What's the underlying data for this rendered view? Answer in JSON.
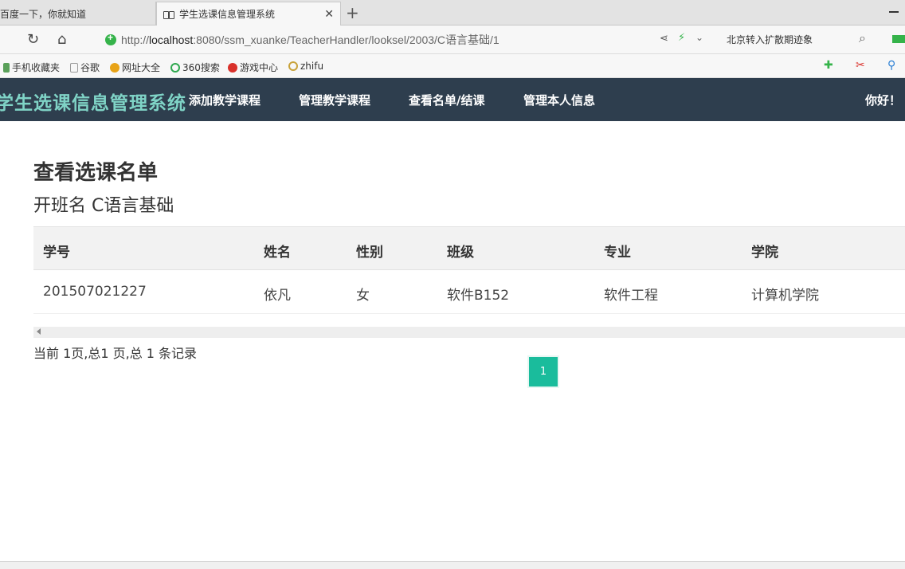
{
  "browser": {
    "tabs": [
      {
        "label": "百度一下，你就知道"
      },
      {
        "label": "学生选课信息管理系统"
      }
    ],
    "url": {
      "prefix": "http://",
      "host": "localhost",
      "rest": ":8080/ssm_xuanke/TeacherHandler/looksel/2003/C语言基础/1"
    },
    "news_ticker": "北京转入扩散期迹象",
    "bookmarks": [
      {
        "label": "手机收藏夹",
        "color": "#5aa05a"
      },
      {
        "label": "谷歌",
        "color": "#9a9a9a"
      },
      {
        "label": "网址大全",
        "color": "#e8a317"
      },
      {
        "label": "360搜索",
        "color": "#2fa84f"
      },
      {
        "label": "游戏中心",
        "color": "#d9312b"
      },
      {
        "label": "zhifu",
        "color": "#c8a23a"
      }
    ]
  },
  "app": {
    "brand": "学生选课信息管理系统",
    "menu": [
      {
        "label": "添加教学课程"
      },
      {
        "label": "管理教学课程"
      },
      {
        "label": "查看名单/结课"
      },
      {
        "label": "管理本人信息"
      }
    ],
    "greeting": "你好！"
  },
  "main": {
    "title": "查看选课名单",
    "subtitle": "开班名 C语言基础",
    "table": {
      "headers": [
        "学号",
        "姓名",
        "性别",
        "班级",
        "专业",
        "学院"
      ],
      "rows": [
        [
          "201507021227",
          "依凡",
          "女",
          "软件B152",
          "软件工程",
          "计算机学院"
        ]
      ]
    },
    "summary": "当前 1页,总1 页,总 1 条记录",
    "pagination": {
      "current": "1"
    }
  },
  "colors": {
    "header_bg": "#2e3e4e",
    "brand_text": "#7fd3c6",
    "accent": "#1abc9c"
  }
}
